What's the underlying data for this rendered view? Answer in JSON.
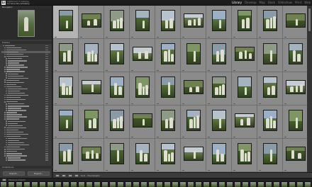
{
  "app": {
    "catalog_name": "Lightroom 5 Catalog",
    "catalog_sub": "Lo-nine-lds-cemetery"
  },
  "modules": [
    {
      "label": "Library",
      "active": true
    },
    {
      "label": "Develop",
      "active": false
    },
    {
      "label": "Map",
      "active": false
    },
    {
      "label": "Book",
      "active": false
    },
    {
      "label": "Slideshow",
      "active": false
    },
    {
      "label": "Print",
      "active": false
    },
    {
      "label": "Web",
      "active": false
    }
  ],
  "left_panel": {
    "navigator_label": "Navigator",
    "folders_label": "Folders",
    "collections_label": "Collections",
    "import_label": "Import...",
    "export_label": "Export..."
  },
  "toolbar": {
    "sort_label": "Sort",
    "thumbnails_label": "Thumbnails"
  },
  "filmstrip": {
    "label": "Previous Import"
  },
  "colors": {
    "grid_bg": "#6e6e6e",
    "cell_bg": "#8b8b8b",
    "selected_cell_bg": "#b4b4b4",
    "panel_bg": "#3a3a3a",
    "active_module": "#ffffff"
  },
  "grid": {
    "rows": 5,
    "columns": 10,
    "selected_index": 0
  }
}
